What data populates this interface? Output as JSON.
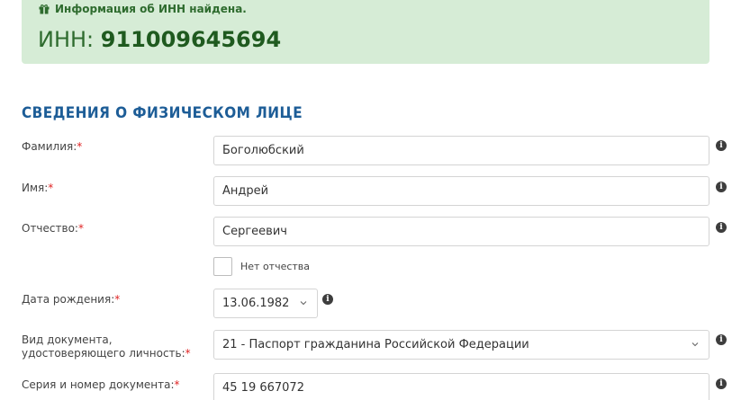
{
  "alert": {
    "message": "Информация об ИНН найдена.",
    "inn_label": "ИНН: ",
    "inn_value": "911009645694",
    "color": "#d6ecd6"
  },
  "section": {
    "title": "СВЕДЕНИЯ О ФИЗИЧЕСКОМ ЛИЦЕ"
  },
  "fields": {
    "surname": {
      "label": "Фамилия:",
      "required": "*",
      "value": "Боголюбский"
    },
    "name": {
      "label": "Имя:",
      "required": "*",
      "value": "Андрей"
    },
    "patronymic": {
      "label": "Отчество:",
      "required": "*",
      "value": "Сергеевич"
    },
    "no_patronymic": {
      "label": "Нет отчества",
      "checked": false
    },
    "birth_date": {
      "label": "Дата рождения:",
      "required": "*",
      "value": "13.06.1982"
    },
    "doc_type": {
      "label_line1": "Вид документа,",
      "label_line2": "удостоверяющего личность:",
      "required": "*",
      "value": "21 - Паспорт гражданина Российской Федерации"
    },
    "doc_number": {
      "label": "Серия и номер документа:",
      "required": "*",
      "value": "45 19 667072"
    }
  },
  "colors": {
    "accent": "#1d5d97",
    "success_text": "#2e6b2e",
    "required": "#e02424"
  },
  "icons": {
    "alert": "gift-icon",
    "help": "info-icon",
    "dropdown": "chevron-down-icon"
  }
}
